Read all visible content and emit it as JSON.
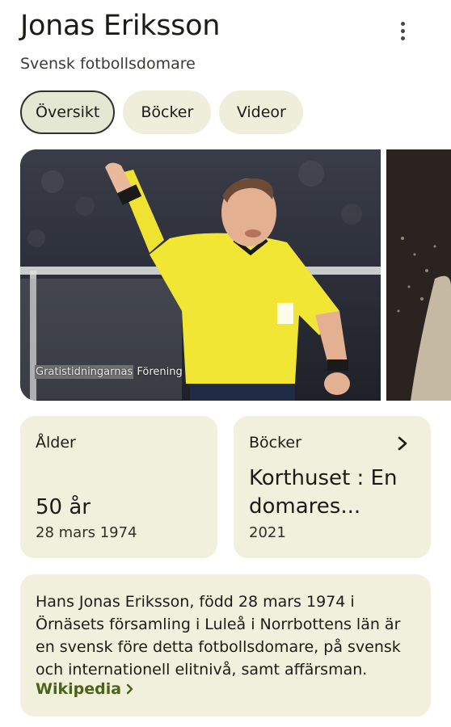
{
  "header": {
    "title": "Jonas Eriksson",
    "subtitle": "Svensk fotbollsdomare"
  },
  "tabs": [
    {
      "label": "Översikt",
      "active": true
    },
    {
      "label": "Böcker",
      "active": false
    },
    {
      "label": "Videor",
      "active": false
    }
  ],
  "image": {
    "credit_part1": "Gratistidningarnas",
    "credit_part2": "Förening"
  },
  "age_card": {
    "label": "Ålder",
    "value": "50 år",
    "birthdate": "28 mars 1974"
  },
  "books_card": {
    "label": "Böcker",
    "title": "Korthuset : En domares...",
    "year": "2021"
  },
  "wiki_card": {
    "text": "Hans Jonas Eriksson, född 28 mars 1974 i Örnäsets församling i Luleå i Norrbottens län är en svensk före detta fotbollsdomare, på svensk och internationell elitnivå, samt affärsman.",
    "link": "Wikipedia"
  },
  "colors": {
    "card_bg": "#f0f0dc",
    "chip_bg": "#eeeedb",
    "link": "#4a6219",
    "jersey": "#f1e633"
  }
}
